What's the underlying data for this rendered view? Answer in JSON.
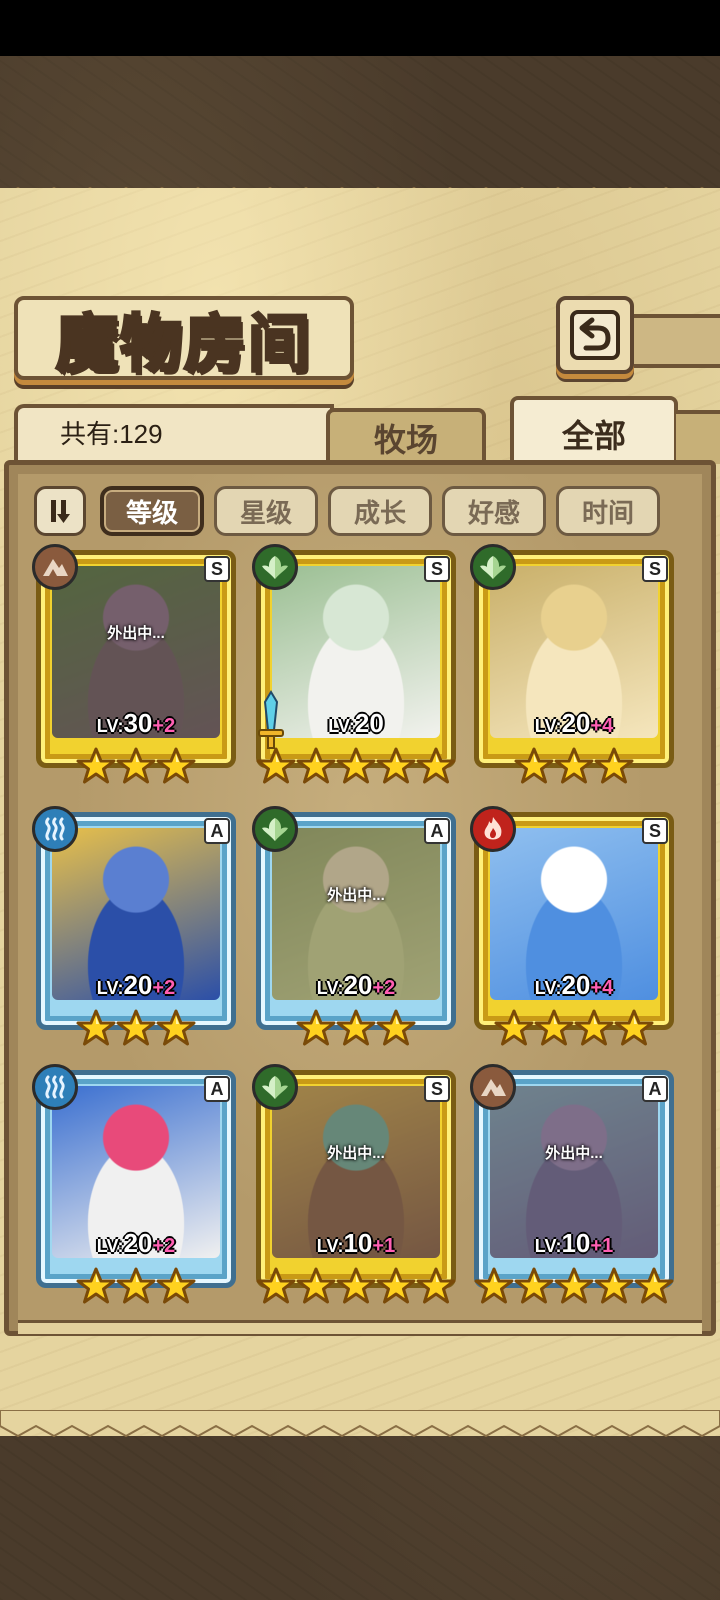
{
  "title": "魔物房间",
  "total_label": "共有:129",
  "tabs": [
    {
      "label": "牧场",
      "active": false
    },
    {
      "label": "全部",
      "active": true
    }
  ],
  "sort_options": [
    {
      "label": "等级",
      "active": true
    },
    {
      "label": "星级",
      "active": false
    },
    {
      "label": "成长",
      "active": false
    },
    {
      "label": "好感",
      "active": false
    },
    {
      "label": "时间",
      "active": false
    }
  ],
  "colors": {
    "gold_frame": "#f1d22f",
    "blue_frame": "#9ed7f0",
    "bonus_text": "#ff5fb3",
    "panel": "#e5d49f"
  },
  "monsters": [
    {
      "element": "earth",
      "element_icon": "earth-mountain-icon",
      "rank": "S",
      "frame": "gold",
      "away": true,
      "away_text": "外出中...",
      "level_prefix": "LV:",
      "level": "30",
      "bonus": "+2",
      "stars": 3,
      "palette": [
        "#5a4a62",
        "#7a5f8a",
        "#3e6b3a"
      ]
    },
    {
      "element": "grass",
      "element_icon": "leaf-icon",
      "rank": "S",
      "frame": "gold",
      "away": false,
      "away_text": "",
      "level_prefix": "LV:",
      "level": "20",
      "bonus": "",
      "stars": 5,
      "weapon": true,
      "weapon_icon": "sword-icon",
      "palette": [
        "#f2f2ee",
        "#d7e7d4",
        "#9bbf93"
      ]
    },
    {
      "element": "grass",
      "element_icon": "leaf-icon",
      "rank": "S",
      "frame": "gold",
      "away": false,
      "away_text": "",
      "level_prefix": "LV:",
      "level": "20",
      "bonus": "+4",
      "stars": 3,
      "palette": [
        "#f5e6bd",
        "#e8d08e",
        "#c9b06a"
      ]
    },
    {
      "element": "water",
      "element_icon": "water-waves-icon",
      "rank": "A",
      "frame": "blue",
      "away": false,
      "away_text": "",
      "level_prefix": "LV:",
      "level": "20",
      "bonus": "+2",
      "stars": 3,
      "palette": [
        "#2b4fa8",
        "#5a7fd1",
        "#e8c04a"
      ]
    },
    {
      "element": "grass",
      "element_icon": "leaf-icon",
      "rank": "A",
      "frame": "blue",
      "away": true,
      "away_text": "外出中...",
      "level_prefix": "LV:",
      "level": "20",
      "bonus": "+2",
      "stars": 3,
      "palette": [
        "#c9d99a",
        "#e8e0c0",
        "#8fa86a"
      ]
    },
    {
      "element": "fire",
      "element_icon": "flame-icon",
      "rank": "S",
      "frame": "gold",
      "away": false,
      "away_text": "",
      "level_prefix": "LV:",
      "level": "20",
      "bonus": "+4",
      "stars": 4,
      "palette": [
        "#4f8fe0",
        "#ffffff",
        "#8fbfef"
      ]
    },
    {
      "element": "water",
      "element_icon": "water-waves-icon",
      "rank": "A",
      "frame": "blue",
      "away": false,
      "away_text": "",
      "level_prefix": "LV:",
      "level": "20",
      "bonus": "+2",
      "stars": 3,
      "palette": [
        "#f0f0f0",
        "#e84a7a",
        "#3a6fd0"
      ]
    },
    {
      "element": "grass",
      "element_icon": "leaf-icon",
      "rank": "S",
      "frame": "gold",
      "away": true,
      "away_text": "外出中...",
      "level_prefix": "LV:",
      "level": "10",
      "bonus": "+1",
      "stars": 5,
      "palette": [
        "#7a5040",
        "#5fa8a0",
        "#c9a24a"
      ]
    },
    {
      "element": "earth",
      "element_icon": "earth-mountain-icon",
      "rank": "A",
      "frame": "blue",
      "away": true,
      "away_text": "外出中...",
      "level_prefix": "LV:",
      "level": "10",
      "bonus": "+1",
      "stars": 5,
      "palette": [
        "#5a5aa0",
        "#8a7ac0",
        "#6fa0c8"
      ]
    }
  ]
}
